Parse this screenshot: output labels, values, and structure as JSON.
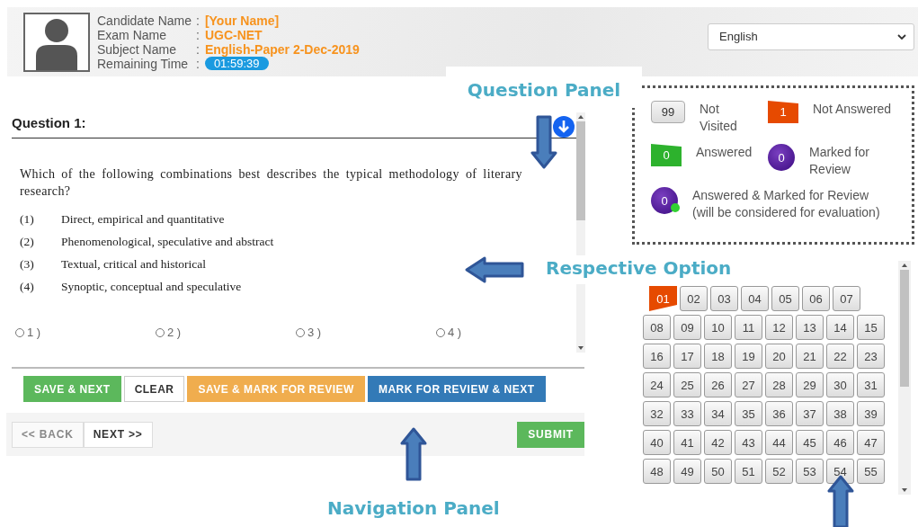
{
  "candidate": {
    "fields": [
      {
        "label": "Candidate Name",
        "separator": ":",
        "value": "[Your Name]",
        "kind": "text"
      },
      {
        "label": "Exam Name",
        "separator": ":",
        "value": "UGC-NET",
        "kind": "text"
      },
      {
        "label": "Subject Name",
        "separator": ":",
        "value": "English-Paper 2-Dec-2019",
        "kind": "text"
      },
      {
        "label": "Remaining Time",
        "separator": ":",
        "value": "01:59:39",
        "kind": "timer"
      }
    ]
  },
  "language": {
    "value": "English"
  },
  "question": {
    "title": "Question 1:",
    "text": "Which of the following combinations best describes the typical methodology of literary research?",
    "choices": [
      {
        "number": "(1)",
        "text": "Direct, empirical and quantitative"
      },
      {
        "number": "(2)",
        "text": "Phenomenological, speculative and abstract"
      },
      {
        "number": "(3)",
        "text": "Textual, critical and historical"
      },
      {
        "number": "(4)",
        "text": "Synoptic, conceptual and speculative"
      }
    ],
    "options": [
      {
        "label": "1 )",
        "selected": false
      },
      {
        "label": "2 )",
        "selected": false
      },
      {
        "label": "3 )",
        "selected": false
      },
      {
        "label": "4 )",
        "selected": false
      }
    ]
  },
  "actions": [
    {
      "label": "SAVE & NEXT",
      "kind": "success"
    },
    {
      "label": "CLEAR",
      "kind": "plain"
    },
    {
      "label": "SAVE & MARK FOR REVIEW",
      "kind": "warning"
    },
    {
      "label": "MARK FOR REVIEW & NEXT",
      "kind": "primary"
    }
  ],
  "navigation": {
    "back": {
      "label": "<< BACK",
      "disabled": true
    },
    "next": {
      "label": "NEXT >>",
      "disabled": false
    },
    "submit": "SUBMIT"
  },
  "legend": [
    {
      "count": "99",
      "label": "Not Visited",
      "kind": "not_visited"
    },
    {
      "count": "1",
      "label": "Not Answered",
      "kind": "not_answered"
    },
    {
      "count": "0",
      "label": "Answered",
      "kind": "answered"
    },
    {
      "count": "0",
      "label": "Marked for Review",
      "kind": "marked"
    },
    {
      "count": "0",
      "label": "Answered & Marked for Review (will be considered for evaluation)",
      "kind": "answered_marked"
    }
  ],
  "palette": {
    "rows": [
      [
        {
          "label": "01",
          "kind": "not_answered"
        },
        {
          "label": "02",
          "kind": "not_visited"
        },
        {
          "label": "03",
          "kind": "not_visited"
        },
        {
          "label": "04",
          "kind": "not_visited"
        },
        {
          "label": "05",
          "kind": "not_visited"
        },
        {
          "label": "06",
          "kind": "not_visited"
        },
        {
          "label": "07",
          "kind": "not_visited"
        }
      ],
      [
        {
          "label": "08",
          "kind": "not_visited"
        },
        {
          "label": "09",
          "kind": "not_visited"
        },
        {
          "label": "10",
          "kind": "not_visited"
        },
        {
          "label": "11",
          "kind": "not_visited"
        },
        {
          "label": "12",
          "kind": "not_visited"
        },
        {
          "label": "13",
          "kind": "not_visited"
        },
        {
          "label": "14",
          "kind": "not_visited"
        },
        {
          "label": "15",
          "kind": "not_visited"
        }
      ],
      [
        {
          "label": "16",
          "kind": "not_visited"
        },
        {
          "label": "17",
          "kind": "not_visited"
        },
        {
          "label": "18",
          "kind": "not_visited"
        },
        {
          "label": "19",
          "kind": "not_visited"
        },
        {
          "label": "20",
          "kind": "not_visited"
        },
        {
          "label": "21",
          "kind": "not_visited"
        },
        {
          "label": "22",
          "kind": "not_visited"
        },
        {
          "label": "23",
          "kind": "not_visited"
        }
      ],
      [
        {
          "label": "24",
          "kind": "not_visited"
        },
        {
          "label": "25",
          "kind": "not_visited"
        },
        {
          "label": "26",
          "kind": "not_visited"
        },
        {
          "label": "27",
          "kind": "not_visited"
        },
        {
          "label": "28",
          "kind": "not_visited"
        },
        {
          "label": "29",
          "kind": "not_visited"
        },
        {
          "label": "30",
          "kind": "not_visited"
        },
        {
          "label": "31",
          "kind": "not_visited"
        }
      ],
      [
        {
          "label": "32",
          "kind": "not_visited"
        },
        {
          "label": "33",
          "kind": "not_visited"
        },
        {
          "label": "34",
          "kind": "not_visited"
        },
        {
          "label": "35",
          "kind": "not_visited"
        },
        {
          "label": "36",
          "kind": "not_visited"
        },
        {
          "label": "37",
          "kind": "not_visited"
        },
        {
          "label": "38",
          "kind": "not_visited"
        },
        {
          "label": "39",
          "kind": "not_visited"
        }
      ],
      [
        {
          "label": "40",
          "kind": "not_visited"
        },
        {
          "label": "41",
          "kind": "not_visited"
        },
        {
          "label": "42",
          "kind": "not_visited"
        },
        {
          "label": "43",
          "kind": "not_visited"
        },
        {
          "label": "44",
          "kind": "not_visited"
        },
        {
          "label": "45",
          "kind": "not_visited"
        },
        {
          "label": "46",
          "kind": "not_visited"
        },
        {
          "label": "47",
          "kind": "not_visited"
        }
      ],
      [
        {
          "label": "48",
          "kind": "not_visited"
        },
        {
          "label": "49",
          "kind": "not_visited"
        },
        {
          "label": "50",
          "kind": "not_visited"
        },
        {
          "label": "51",
          "kind": "not_visited"
        },
        {
          "label": "52",
          "kind": "not_visited"
        },
        {
          "label": "53",
          "kind": "not_visited"
        },
        {
          "label": "54",
          "kind": "not_visited"
        },
        {
          "label": "55",
          "kind": "not_visited"
        }
      ]
    ]
  },
  "annotations": [
    {
      "text": "Question Panel",
      "kind": "down"
    },
    {
      "text": "Respective Option",
      "kind": "left"
    },
    {
      "text": "Navigation Panel",
      "kind": "up"
    },
    {
      "kind": "up"
    }
  ]
}
